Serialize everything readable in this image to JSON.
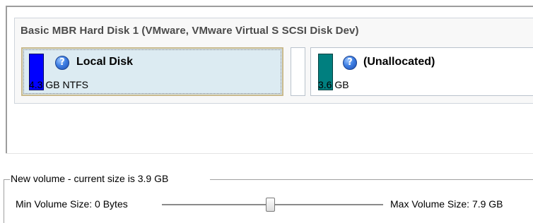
{
  "disk": {
    "title": "Basic MBR Hard Disk 1 (VMware, VMware Virtual S SCSI Disk Dev)",
    "partitions": [
      {
        "name": "Local Disk",
        "size": "4.3 GB NTFS",
        "color": "#0000ff",
        "icon": "help-icon",
        "selected": true
      },
      {
        "name": "(Unallocated)",
        "size": "3.6 GB",
        "color": "#007f7f",
        "icon": "help-icon",
        "selected": false
      }
    ]
  },
  "new_volume": {
    "legend": "New volume - current size is 3.9 GB",
    "min_label": "Min Volume Size:  0 Bytes",
    "max_label": "Max Volume Size:  7.9 GB",
    "slider_fraction": 0.49
  },
  "icons": {
    "help_glyph": "?"
  }
}
